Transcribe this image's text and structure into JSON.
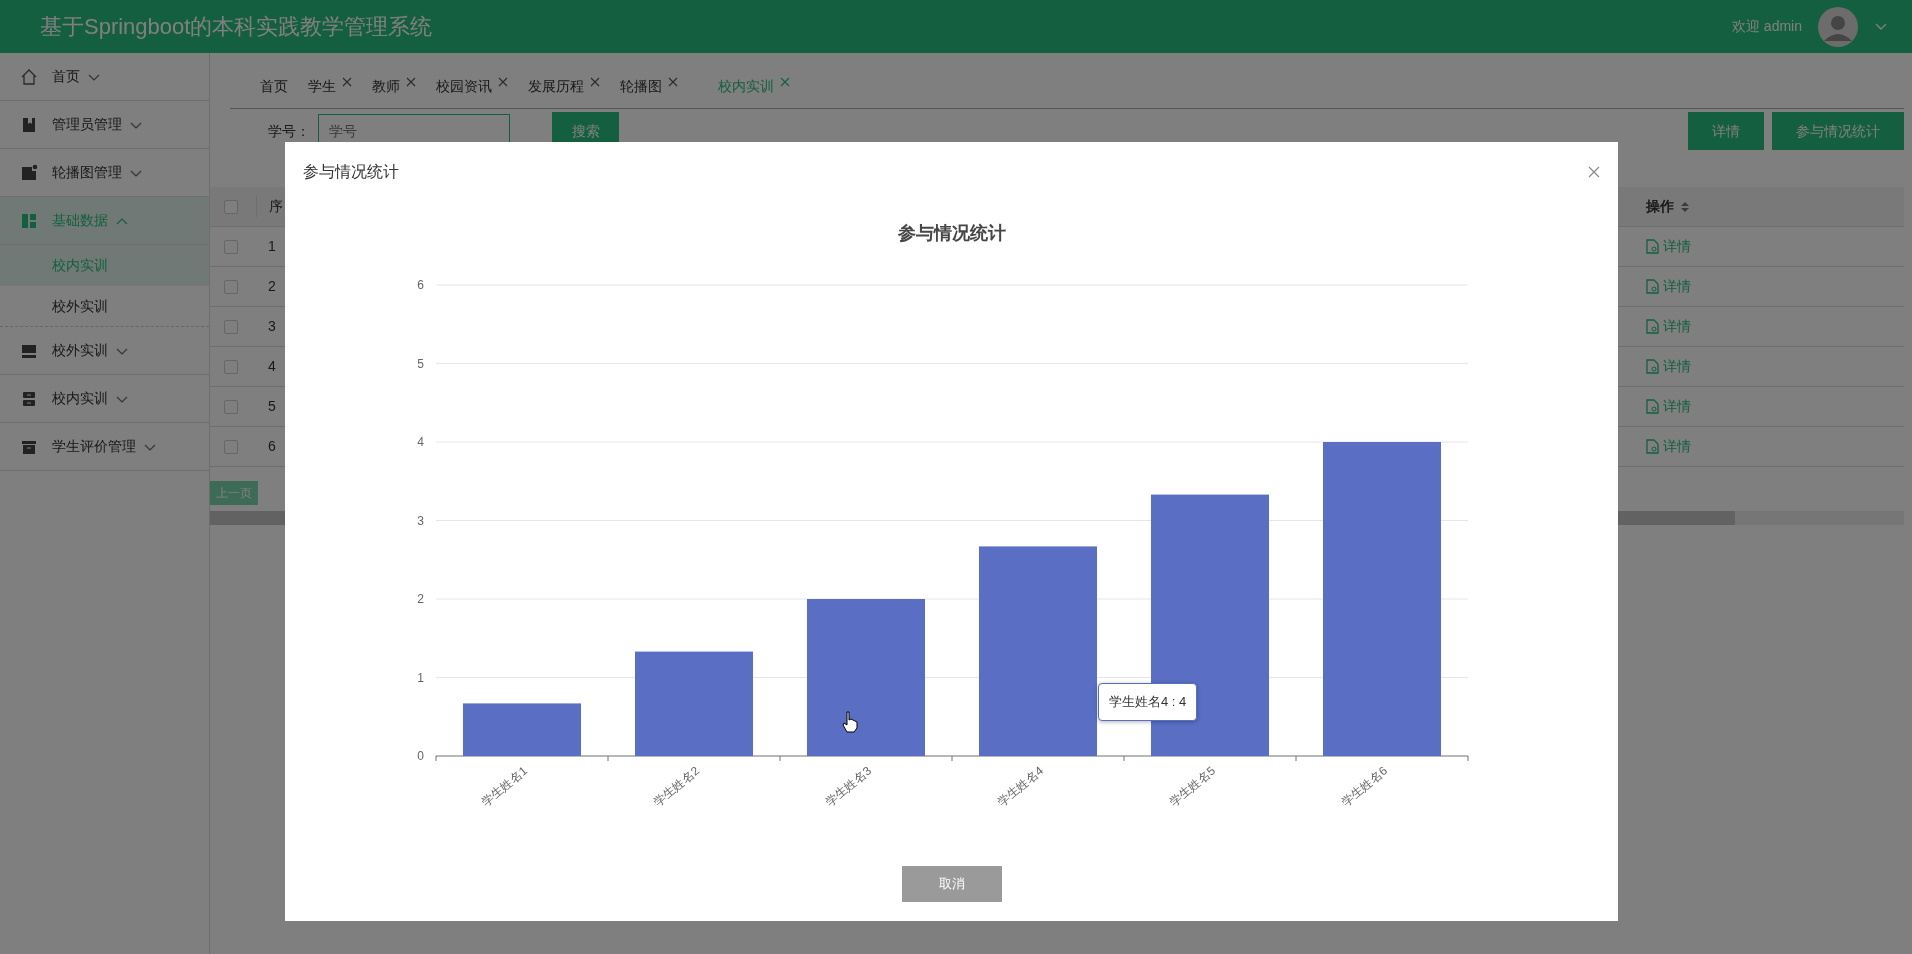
{
  "header": {
    "title": "基于Springboot的本科实践教学管理系统",
    "welcome": "欢迎 admin"
  },
  "sidebar": {
    "items": [
      {
        "label": "首页",
        "kind": "home",
        "expanded": false,
        "selected": false
      },
      {
        "label": "管理员管理",
        "kind": "book",
        "expanded": false,
        "selected": false
      },
      {
        "label": "轮播图管理",
        "kind": "image",
        "expanded": false,
        "selected": false
      },
      {
        "label": "基础数据",
        "kind": "grid",
        "expanded": true,
        "selected": true,
        "children": [
          {
            "label": "校内实训",
            "selected": true
          },
          {
            "label": "校外实训",
            "selected": false
          }
        ]
      },
      {
        "label": "校外实训",
        "kind": "monitor",
        "expanded": false,
        "selected": false
      },
      {
        "label": "校内实训",
        "kind": "drawer",
        "expanded": false,
        "selected": false
      },
      {
        "label": "学生评价管理",
        "kind": "archive",
        "expanded": false,
        "selected": false
      }
    ]
  },
  "tabs": [
    {
      "label": "首页",
      "closable": false,
      "selected": false
    },
    {
      "label": "学生",
      "closable": true,
      "selected": false
    },
    {
      "label": "教师",
      "closable": true,
      "selected": false
    },
    {
      "label": "校园资讯",
      "closable": true,
      "selected": false
    },
    {
      "label": "发展历程",
      "closable": true,
      "selected": false
    },
    {
      "label": "轮播图",
      "closable": true,
      "selected": false
    },
    {
      "label": "校内实训",
      "closable": true,
      "selected": true
    }
  ],
  "search": {
    "label": "学号：",
    "placeholder": "学号",
    "button": "搜索"
  },
  "actions": [
    "详情",
    "参与情况统计"
  ],
  "table": {
    "columns": [
      "序",
      "操作"
    ],
    "all_checked": false,
    "rows": [
      {
        "checked": false,
        "index": "1",
        "action": "详情"
      },
      {
        "checked": false,
        "index": "2",
        "action": "详情"
      },
      {
        "checked": false,
        "index": "3",
        "action": "详情"
      },
      {
        "checked": false,
        "index": "4",
        "action": "详情"
      },
      {
        "checked": false,
        "index": "5",
        "action": "详情"
      },
      {
        "checked": false,
        "index": "6",
        "action": "详情"
      }
    ]
  },
  "pagination": {
    "prev": "上一页"
  },
  "modal": {
    "title": "参与情况统计",
    "chart_data": {
      "type": "bar",
      "title": "参与情况统计",
      "categories": [
        "学生姓名1",
        "学生姓名2",
        "学生姓名3",
        "学生姓名4",
        "学生姓名5",
        "学生姓名6"
      ],
      "series": [
        {
          "color": "#5a6fc4",
          "values": [
            0.67,
            1.33,
            2,
            2.67,
            3.33,
            4
          ]
        }
      ],
      "ylim": [
        0,
        6
      ],
      "yticks": [
        0,
        1,
        2,
        3,
        4,
        5,
        6
      ],
      "grid": true
    },
    "tooltip": "学生姓名4 : 4",
    "cancel": "取消"
  }
}
